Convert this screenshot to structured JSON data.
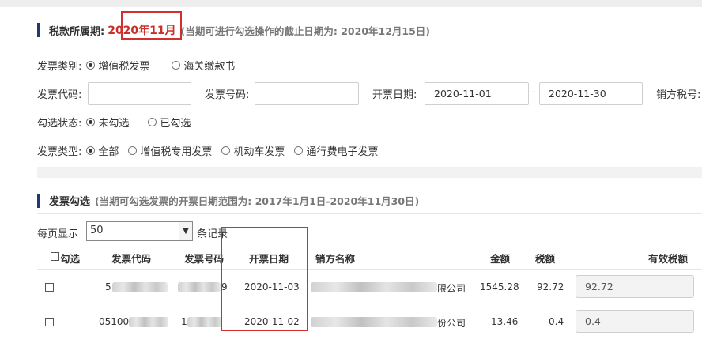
{
  "tax_period": {
    "label": "税款所属期:",
    "value": "2020年11月",
    "note": "(当期可进行勾选操作的截止日期为: 2020年12月15日)"
  },
  "filters": {
    "invoice_category": {
      "label": "发票类别:",
      "options": [
        "增值税发票",
        "海关缴款书"
      ],
      "selected": "增值税发票"
    },
    "invoice_code": {
      "label": "发票代码:",
      "value": ""
    },
    "invoice_number": {
      "label": "发票号码:",
      "value": ""
    },
    "issue_date": {
      "label": "开票日期:",
      "from": "2020-11-01",
      "separator": "-",
      "to": "2020-11-30"
    },
    "seller_tax_no": {
      "label": "销方税号:"
    },
    "check_status": {
      "label": "勾选状态:",
      "options": [
        "未勾选",
        "已勾选"
      ],
      "selected": "未勾选"
    },
    "invoice_type": {
      "label": "发票类型:",
      "options": [
        "全部",
        "增值税专用发票",
        "机动车发票",
        "通行费电子发票"
      ],
      "selected": "全部"
    }
  },
  "selection": {
    "title": "发票勾选",
    "note": "(当期可勾选发票的开票日期范围为: 2017年1月1日-2020年11月30日)",
    "per_page_label": "每页显示",
    "per_page_value": "50",
    "per_page_suffix": "条记录"
  },
  "table": {
    "headers": {
      "check": "勾选",
      "code": "发票代码",
      "number": "发票号码",
      "date": "开票日期",
      "seller": "销方名称",
      "amount": "金额",
      "tax": "税额",
      "valid_tax": "有效税额"
    },
    "rows": [
      {
        "code": "5",
        "number": "9",
        "date": "2020-11-03",
        "seller": "限公司",
        "amount": "1545.28",
        "tax": "92.72",
        "valid_tax": "92.72"
      },
      {
        "code": "05100",
        "number": "1",
        "date": "2020-11-02",
        "seller": "份公司",
        "amount": "13.46",
        "tax": "0.4",
        "valid_tax": "0.4"
      }
    ]
  }
}
